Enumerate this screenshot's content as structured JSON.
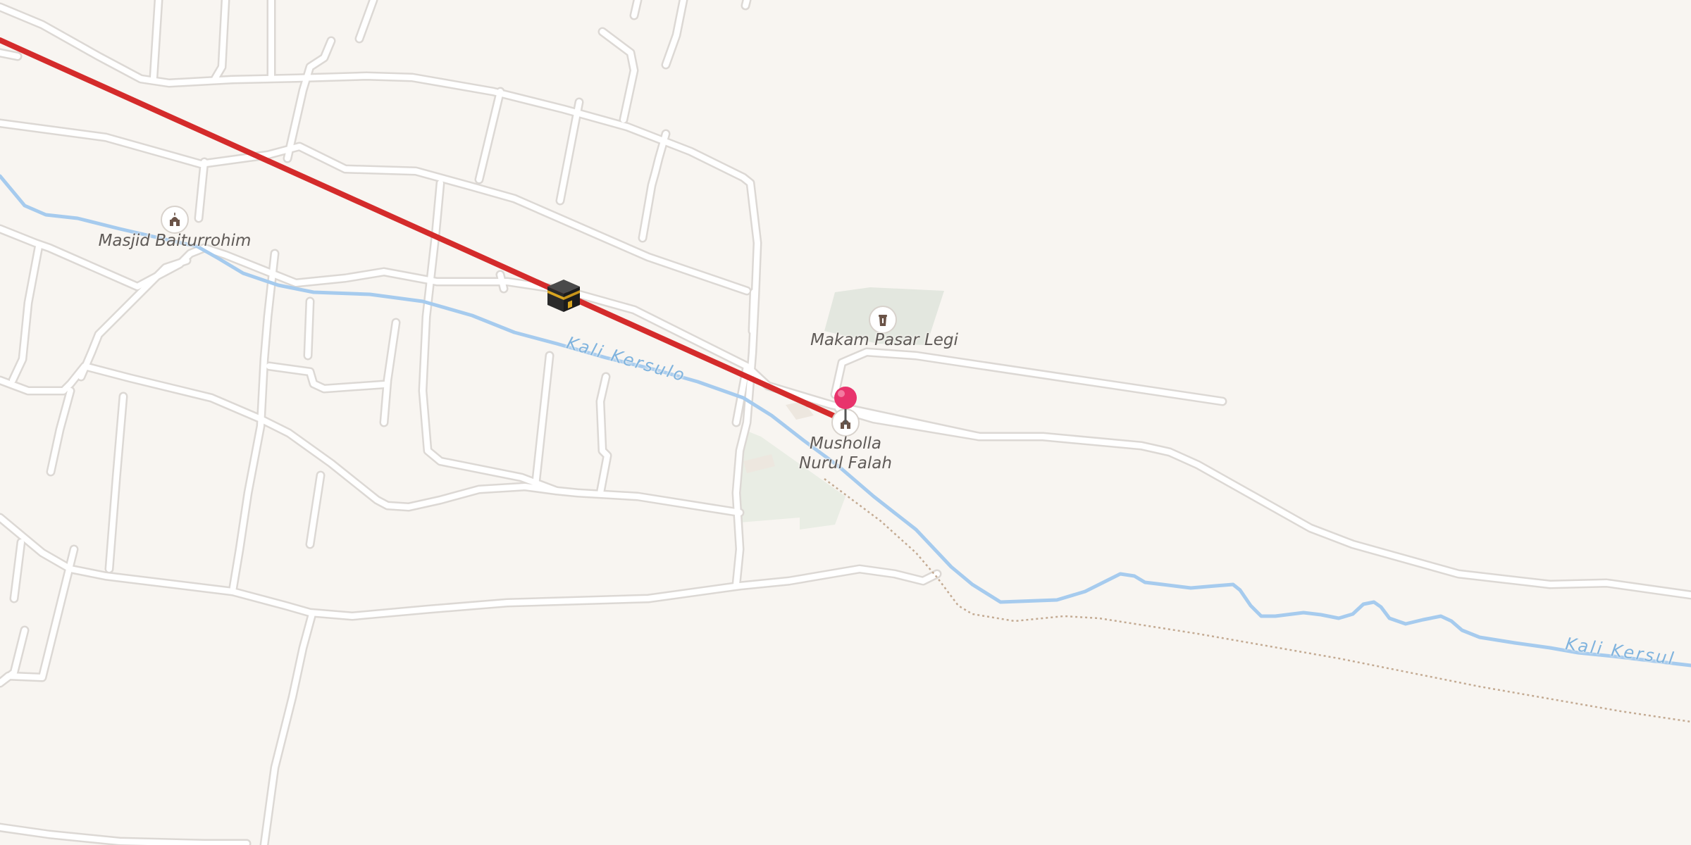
{
  "map": {
    "pois": [
      {
        "id": "masjid-baiturrohim",
        "label": "Masjid Baiturrohim",
        "icon": "mosque-icon"
      },
      {
        "id": "makam-pasar-legi",
        "label": "Makam Pasar Legi",
        "icon": "grave-icon"
      },
      {
        "id": "musholla-nurul-falah",
        "label_line1": "Musholla",
        "label_line2": "Nurul Falah",
        "icon": "mosque-icon"
      }
    ],
    "rivers": [
      {
        "label": "Kali Kersulo"
      },
      {
        "label": "Kali Kersul"
      }
    ],
    "markers": {
      "qibla_icon": "kaaba-icon",
      "location_pin": "map-pin-icon"
    },
    "colors": {
      "background": "#f8f5f1",
      "road": "#ffffff",
      "road_casing": "#dedad6",
      "river": "#a6cbee",
      "qibla_line": "#d42b2b",
      "pin": "#e8336c",
      "park": "#e8ebe3",
      "cemetery": "#e1e5dd",
      "path": "#c4ab93"
    }
  }
}
